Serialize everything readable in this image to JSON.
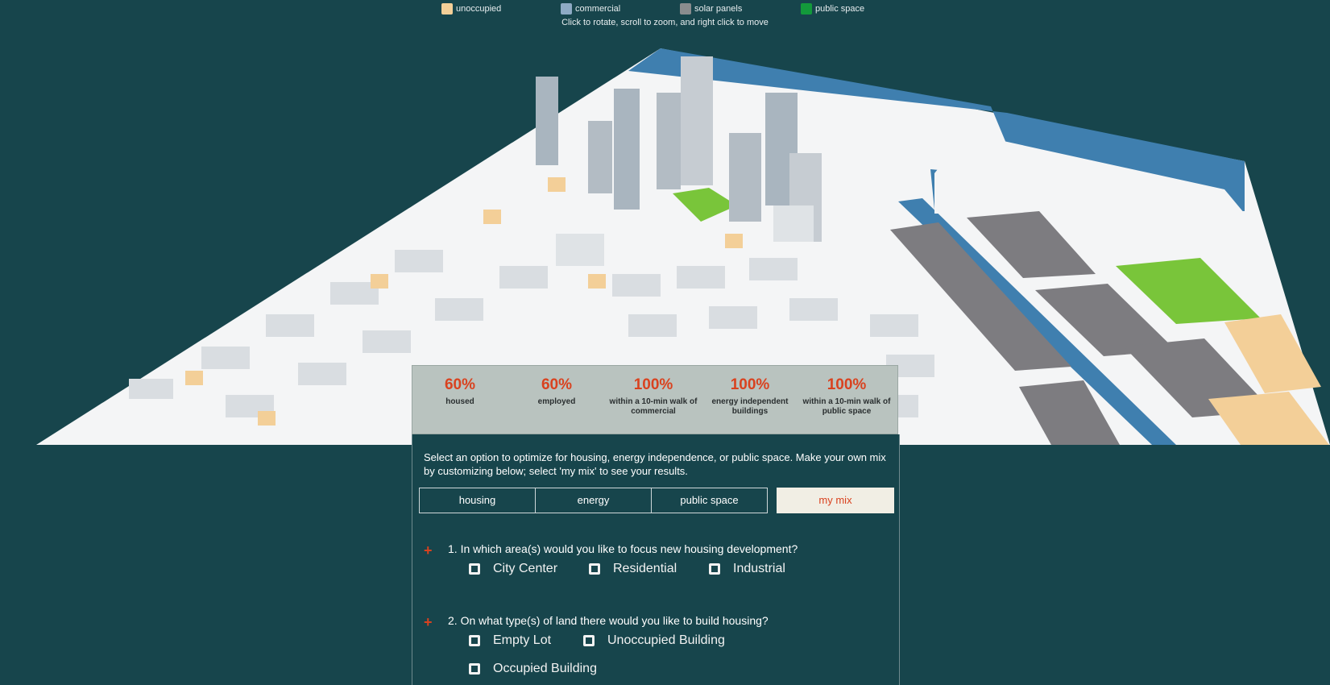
{
  "legend": [
    {
      "label": "unoccupied",
      "color": "#f3cf98"
    },
    {
      "label": "commercial",
      "color": "#8eaac4"
    },
    {
      "label": "solar panels",
      "color": "#8a8c8e"
    },
    {
      "label": "public space",
      "color": "#139a3b"
    }
  ],
  "hint": "Click to rotate, scroll to zoom, and right click to move",
  "stats": [
    {
      "value": "60%",
      "label": "housed"
    },
    {
      "value": "60%",
      "label": "employed"
    },
    {
      "value": "100%",
      "label": "within a 10-min walk of commercial"
    },
    {
      "value": "100%",
      "label": "energy independent buildings"
    },
    {
      "value": "100%",
      "label": "within a 10-min walk of public space"
    }
  ],
  "intro": "Select an option to optimize for housing, energy independence, or public space. Make your own mix by customizing below; select 'my mix' to see your results.",
  "options": [
    {
      "label": "housing",
      "active": false
    },
    {
      "label": "energy",
      "active": false
    },
    {
      "label": "public space",
      "active": false
    },
    {
      "label": "my mix",
      "active": true
    }
  ],
  "questions": [
    {
      "text": "1. In which area(s) would you like to focus new housing development?",
      "choices": [
        "City Center",
        "Residential",
        "Industrial"
      ]
    },
    {
      "text": "2. On what type(s) of land there would you like to build housing?",
      "choices": [
        "Empty Lot",
        "Unoccupied Building",
        "Occupied Building"
      ]
    }
  ],
  "colors": {
    "water": "#3f7faf",
    "ground": "#f4f5f6",
    "building": "#d9dde1",
    "tower": "#a9b5bf",
    "park": "#79c53a",
    "solar": "#7d7c80",
    "unoccupied": "#f3cf98",
    "accent": "#d9421f"
  }
}
